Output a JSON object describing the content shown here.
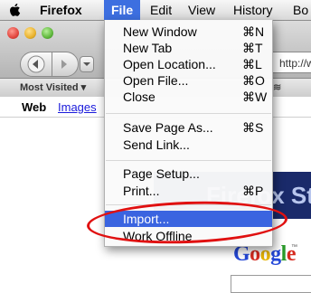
{
  "menubar": {
    "items": [
      {
        "label": "Firefox"
      },
      {
        "label": "File"
      },
      {
        "label": "Edit"
      },
      {
        "label": "View"
      },
      {
        "label": "History"
      },
      {
        "label": "Bo"
      }
    ]
  },
  "browser": {
    "address_partial": "http://www",
    "bookmarks": {
      "most_visited": "Most Visited",
      "dropdown_glyph": "▾"
    },
    "google_bar": {
      "web": "Web",
      "images": "Images"
    },
    "banner_text": "Firefox St",
    "logo_text": "Google",
    "tm": "™"
  },
  "file_menu": {
    "items": [
      {
        "label": "New Window",
        "shortcut": "⌘N"
      },
      {
        "label": "New Tab",
        "shortcut": "⌘T"
      },
      {
        "label": "Open Location...",
        "shortcut": "⌘L"
      },
      {
        "label": "Open File...",
        "shortcut": "⌘O"
      },
      {
        "label": "Close",
        "shortcut": "⌘W"
      },
      {
        "label": "Save Page As...",
        "shortcut": "⌘S"
      },
      {
        "label": "Send Link...",
        "shortcut": ""
      },
      {
        "label": "Page Setup...",
        "shortcut": ""
      },
      {
        "label": "Print...",
        "shortcut": "⌘P"
      },
      {
        "label": "Import...",
        "shortcut": "",
        "highlighted": true
      },
      {
        "label": "Work Offline",
        "shortcut": ""
      }
    ]
  },
  "colors": {
    "menu_highlight": "#3a64e0",
    "annotation": "#e01010",
    "close": "#e2463f",
    "minimize": "#e9b22d",
    "zoom": "#5fb73c"
  }
}
